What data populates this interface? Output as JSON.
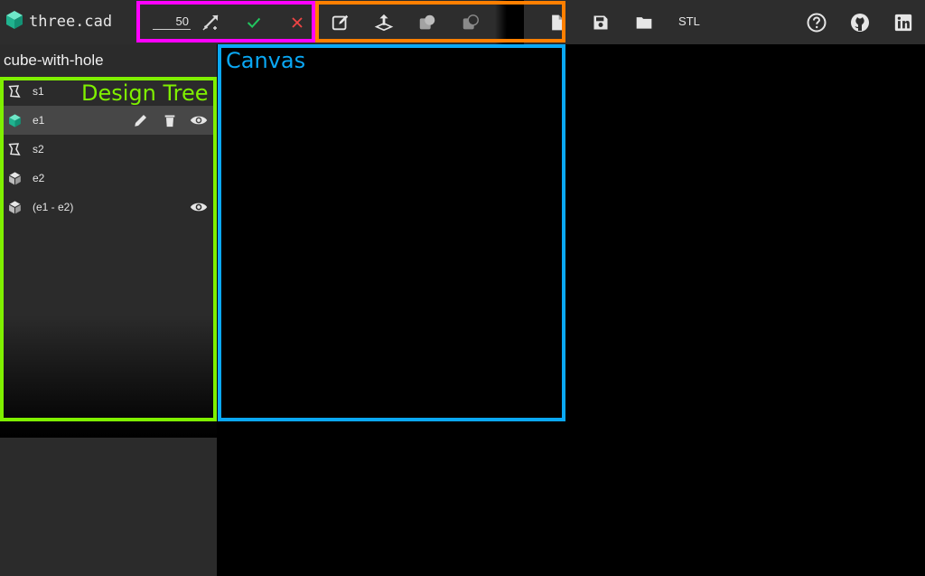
{
  "app": {
    "title": "three.cad"
  },
  "toolbar": {
    "extrude_depth": "50",
    "export_stl_label": "STL"
  },
  "project": {
    "name": "cube-with-hole"
  },
  "tree": {
    "items": [
      {
        "label": "s1",
        "type": "sketch"
      },
      {
        "label": "e1",
        "type": "solid",
        "selected": true
      },
      {
        "label": "s2",
        "type": "sketch"
      },
      {
        "label": "e2",
        "type": "solid"
      },
      {
        "label": "(e1 - e2)",
        "type": "solid"
      }
    ]
  },
  "annotations": {
    "design_tree": "Design Tree",
    "canvas": "Canvas"
  },
  "colors": {
    "accent_teal": "#20b38f",
    "confirm_green": "#22c55e",
    "cancel_red": "#ef4444",
    "highlight_magenta": "#ff00ff",
    "highlight_orange": "#ff7f00",
    "highlight_blue": "#0aa8f5",
    "highlight_green": "#7ff000"
  }
}
